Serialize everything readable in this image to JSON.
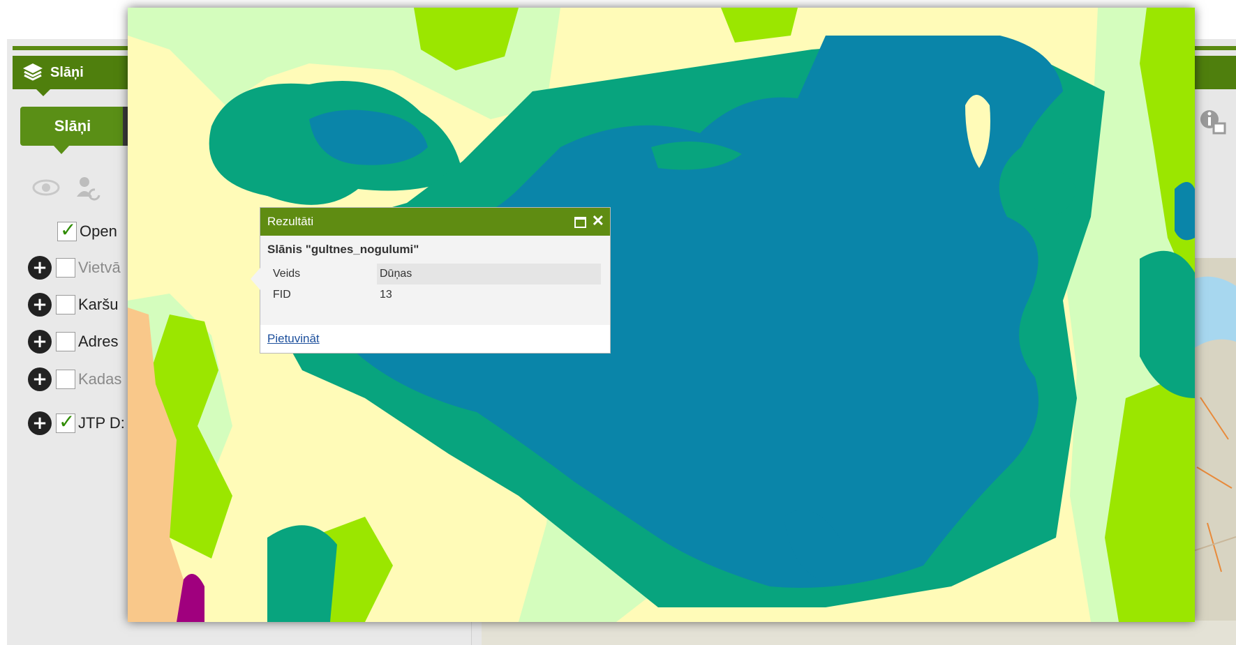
{
  "panel": {
    "header_title": "Slāņi",
    "tab_label": "Slāņi",
    "toolbar_icons": [
      "eye-icon",
      "user-refresh-icon"
    ],
    "layers": [
      {
        "label": "Open",
        "checked": true,
        "expandable": false,
        "muted": false
      },
      {
        "label": "Vietvā",
        "checked": false,
        "expandable": true,
        "muted": true
      },
      {
        "label": "Karšu",
        "checked": false,
        "expandable": true,
        "muted": false
      },
      {
        "label": "Adres",
        "checked": false,
        "expandable": true,
        "muted": false
      },
      {
        "label": "Kadas",
        "checked": false,
        "expandable": true,
        "muted": true
      },
      {
        "label": "JTP D:",
        "checked": true,
        "expandable": true,
        "muted": false
      }
    ]
  },
  "colors": {
    "header_green": "#4f7f0d",
    "deep_water": "#0a85a9",
    "teal": "#08a47e",
    "lime": "#9be600",
    "light_green": "#d4fdbd",
    "light_yellow": "#fffbb8",
    "orange": "#f9c88a",
    "magenta": "#a0007e"
  },
  "popup": {
    "title": "Rezultāti",
    "layer_title": "Slānis \"gultnes_nogulumi\"",
    "attributes": [
      {
        "key": "Veids",
        "value": "Dūņas"
      },
      {
        "key": "FID",
        "value": "13"
      }
    ],
    "zoom_link": "Pietuvināt"
  }
}
